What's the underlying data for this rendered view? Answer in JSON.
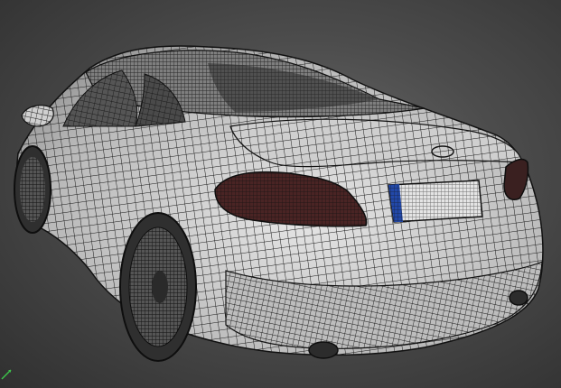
{
  "scene": {
    "subject": "car",
    "view": "wireframe",
    "colors": {
      "background_center": "#6a6a6a",
      "background_edge": "#303030",
      "body_fill": "#d9d9d9",
      "wire_color": "#1a1a1a",
      "taillight": "#5a2a2a",
      "plate_fill": "#e8e8e8",
      "plate_eu_band": "#2248a8",
      "axis_y": "#3cc24a"
    },
    "icons": [
      "axis-gizmo-icon"
    ]
  }
}
